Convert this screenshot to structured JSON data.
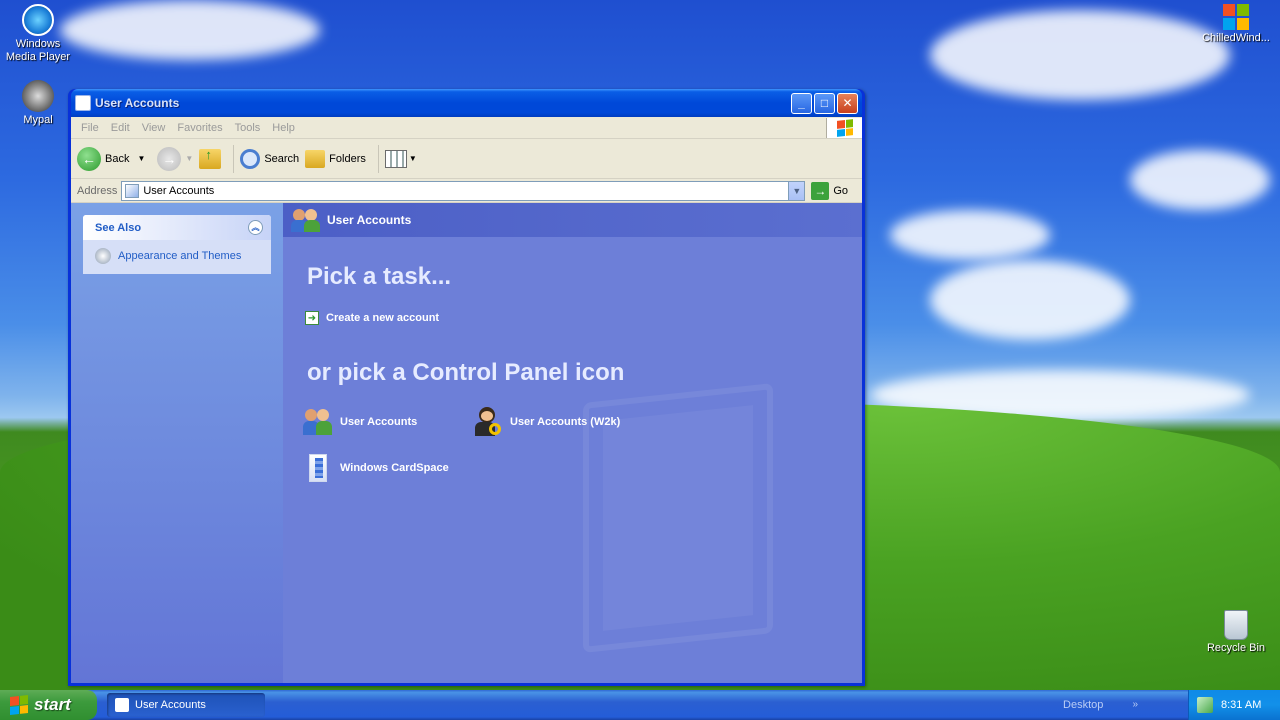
{
  "desktop": {
    "icons": {
      "wmp": "Windows\nMedia Player",
      "mypal": "Mypal",
      "chilled": "ChilledWind...",
      "recycle": "Recycle Bin"
    }
  },
  "window": {
    "title": "User Accounts",
    "menu": [
      "File",
      "Edit",
      "View",
      "Favorites",
      "Tools",
      "Help"
    ],
    "toolbar": {
      "back": "Back",
      "search": "Search",
      "folders": "Folders"
    },
    "address": {
      "label": "Address",
      "value": "User Accounts",
      "go": "Go"
    },
    "see_also": {
      "title": "See Also",
      "link": "Appearance and Themes"
    },
    "main": {
      "header": "User Accounts",
      "pick_task": "Pick a task...",
      "task": "Create a new account",
      "pick_icon": "or pick a Control Panel icon",
      "icons": [
        "User Accounts",
        "User Accounts (W2k)",
        "Windows CardSpace"
      ]
    }
  },
  "taskbar": {
    "start": "start",
    "item": "User Accounts",
    "desktop": "Desktop",
    "time": "8:31 AM"
  }
}
